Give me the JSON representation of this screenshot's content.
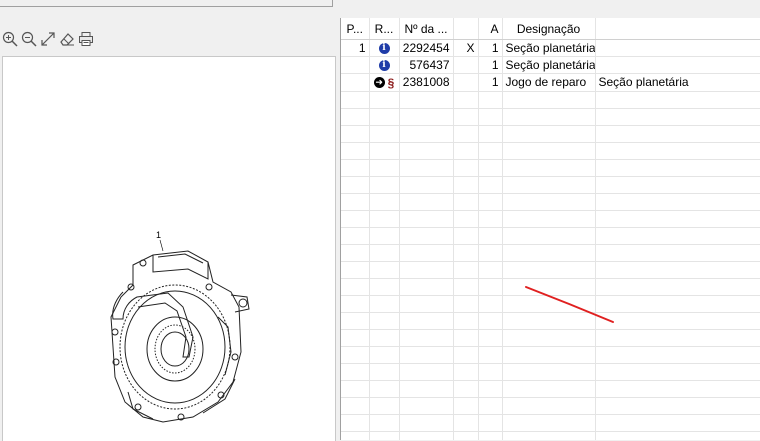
{
  "window": {
    "toolbar_icons": [
      "zoom-in-icon",
      "zoom-out-icon",
      "fit-to-window-icon",
      "eraser-icon",
      "print-icon"
    ]
  },
  "drawing": {
    "callout": "1"
  },
  "grid": {
    "headers": {
      "pos": "P...",
      "ref": "R...",
      "part_no": "Nº da ...",
      "x": "",
      "qty": "A",
      "designation": "Designação",
      "extra": ""
    },
    "rows": [
      {
        "pos": "1",
        "icon": "info-icon",
        "icon2": "",
        "part_no": "2292454",
        "x": "X",
        "qty": "1",
        "designation": "Seção planetária",
        "extra": ""
      },
      {
        "pos": "",
        "icon": "info-icon",
        "icon2": "",
        "part_no": "576437",
        "x": "",
        "qty": "1",
        "designation": "Seção planetária",
        "extra": ""
      },
      {
        "pos": "",
        "icon": "arrow-right-circle-icon",
        "icon2": "section-icon",
        "part_no": "2381008",
        "x": "",
        "qty": "1",
        "designation": "Jogo de reparo",
        "extra": "Seção planetária"
      }
    ]
  },
  "colors": {
    "info_icon": "#1f3ca8",
    "annotation_stroke": "#e02020",
    "section_icon": "#8b1a1a"
  }
}
